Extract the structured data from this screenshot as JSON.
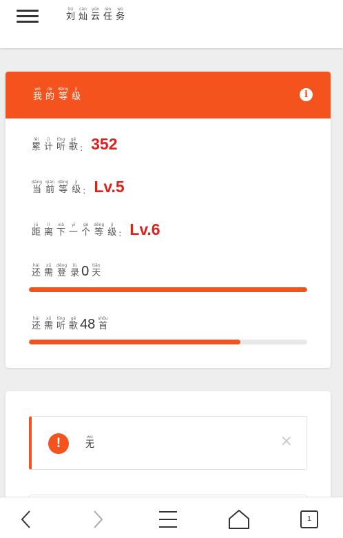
{
  "header": {
    "title_chars": [
      {
        "p": "liú",
        "h": "刘"
      },
      {
        "p": "càn",
        "h": "灿"
      },
      {
        "p": "yún",
        "h": "云"
      },
      {
        "p": "rèn",
        "h": "任"
      },
      {
        "p": "wù",
        "h": "务"
      }
    ]
  },
  "level_card": {
    "title_chars": [
      {
        "p": "wǒ",
        "h": "我"
      },
      {
        "p": "de",
        "h": "的"
      },
      {
        "p": "děng",
        "h": "等"
      },
      {
        "p": "jí",
        "h": "级"
      }
    ],
    "info_icon": "i",
    "rows": [
      {
        "label_chars": [
          {
            "p": "lěi",
            "h": "累"
          },
          {
            "p": "jì",
            "h": "计"
          },
          {
            "p": "tīng",
            "h": "听"
          },
          {
            "p": "gē",
            "h": "歌"
          }
        ],
        "colon": ":",
        "value": "352"
      },
      {
        "label_chars": [
          {
            "p": "dāng",
            "h": "当"
          },
          {
            "p": "qián",
            "h": "前"
          },
          {
            "p": "děng",
            "h": "等"
          },
          {
            "p": "jí",
            "h": "级"
          }
        ],
        "colon": ":",
        "value": "Lv.5"
      },
      {
        "label_chars": [
          {
            "p": "jù",
            "h": "距"
          },
          {
            "p": "lí",
            "h": "离"
          },
          {
            "p": "xià",
            "h": "下"
          },
          {
            "p": "yī",
            "h": "一"
          },
          {
            "p": "gè",
            "h": "个"
          },
          {
            "p": "děng",
            "h": "等"
          },
          {
            "p": "jí",
            "h": "级"
          }
        ],
        "colon": ":",
        "value": "Lv.6"
      }
    ],
    "progress": [
      {
        "pre_chars": [
          {
            "p": "hái",
            "h": "还"
          },
          {
            "p": "xū",
            "h": "需"
          },
          {
            "p": "dēng",
            "h": "登"
          },
          {
            "p": "lù",
            "h": "录"
          }
        ],
        "value": "0",
        "post_chars": [
          {
            "p": "tiān",
            "h": "天"
          }
        ],
        "fraction": 1.0
      },
      {
        "pre_chars": [
          {
            "p": "hái",
            "h": "还"
          },
          {
            "p": "xū",
            "h": "需"
          },
          {
            "p": "tīng",
            "h": "听"
          },
          {
            "p": "gē",
            "h": "歌"
          }
        ],
        "value": "48",
        "post_chars": [
          {
            "p": "shǒu",
            "h": "首"
          }
        ],
        "fraction": 0.76
      }
    ]
  },
  "notice": {
    "icon": "!",
    "text_chars": [
      {
        "p": "wú",
        "h": "无"
      }
    ],
    "close": "×"
  },
  "bottom_nav": {
    "tabs_count": "1"
  },
  "colors": {
    "accent": "#f5531e",
    "value_red": "#e0201b"
  }
}
